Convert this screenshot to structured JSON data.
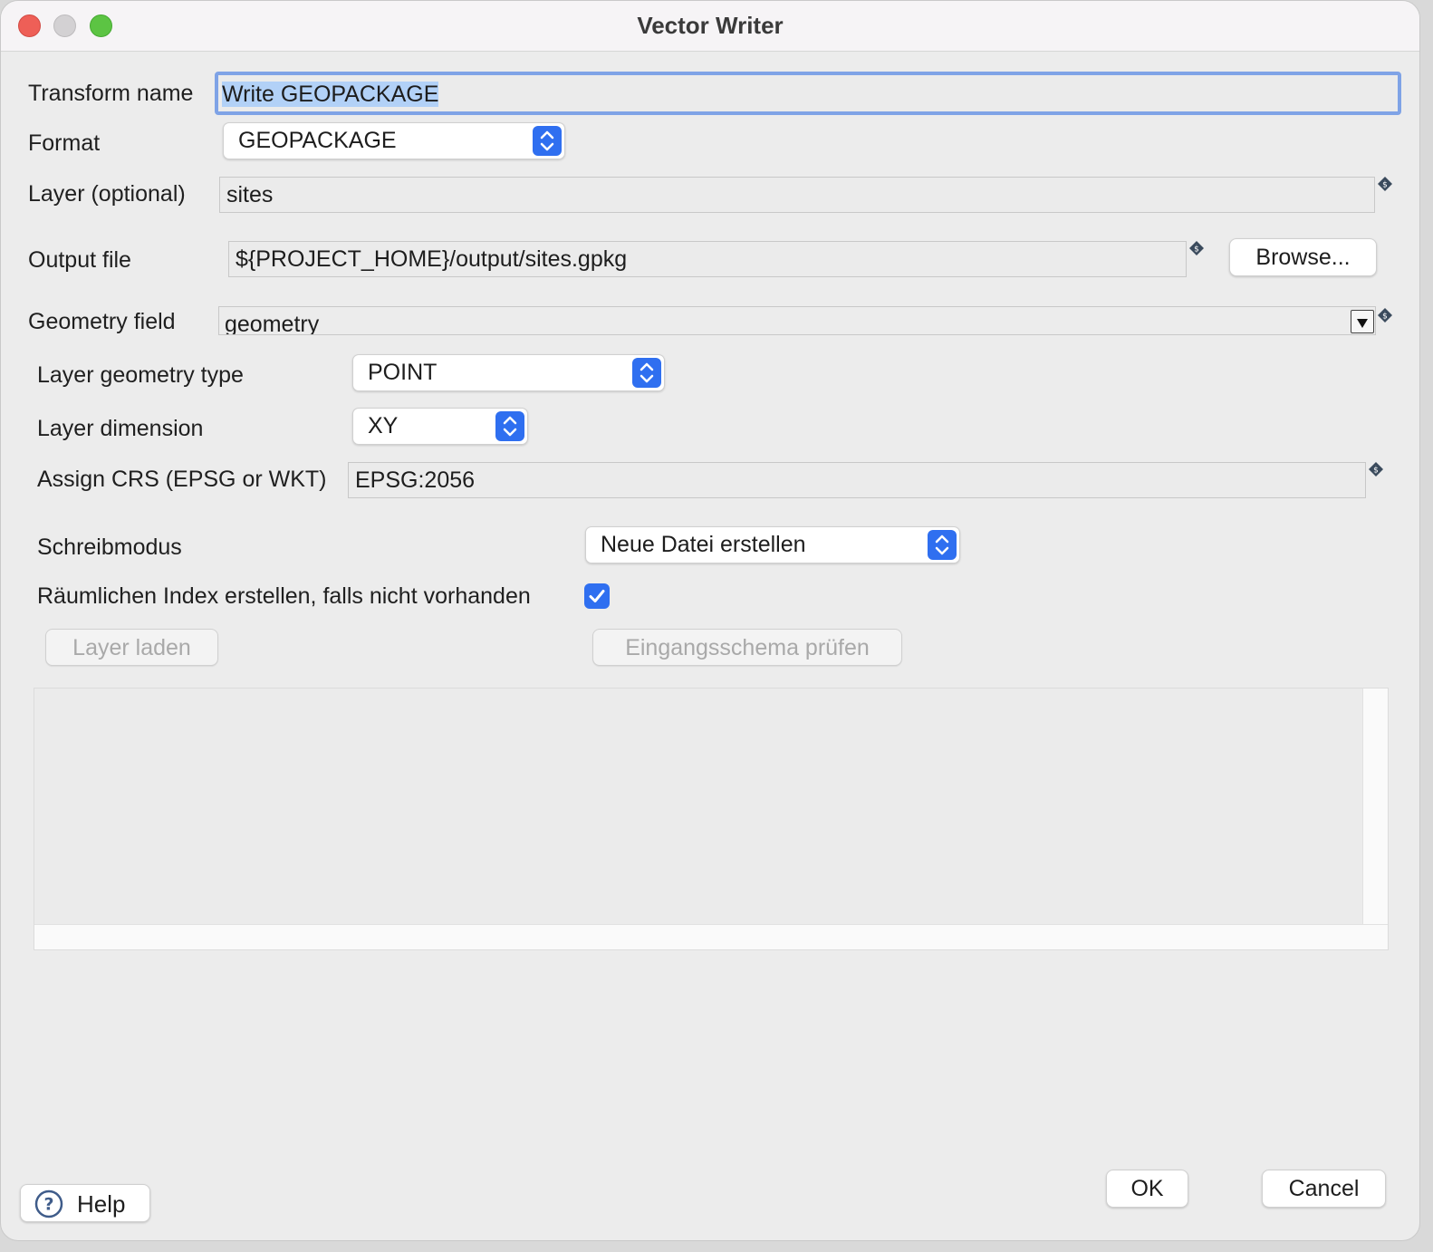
{
  "window": {
    "title": "Vector Writer"
  },
  "form": {
    "transform_name": {
      "label": "Transform name",
      "value": "Write GEOPACKAGE"
    },
    "format": {
      "label": "Format",
      "value": "GEOPACKAGE"
    },
    "layer": {
      "label": "Layer (optional)",
      "value": "sites"
    },
    "output_file": {
      "label": "Output file",
      "value": "${PROJECT_HOME}/output/sites.gpkg",
      "browse_label": "Browse..."
    },
    "geometry_field": {
      "label": "Geometry field",
      "value": "geometry"
    },
    "layer_geometry_type": {
      "label": "Layer geometry type",
      "value": "POINT"
    },
    "layer_dimension": {
      "label": "Layer dimension",
      "value": "XY"
    },
    "assign_crs": {
      "label": "Assign CRS (EPSG or WKT)",
      "value": "EPSG:2056"
    },
    "write_mode": {
      "label": "Schreibmodus",
      "value": "Neue Datei erstellen"
    },
    "spatial_index": {
      "label": "Räumlichen Index erstellen, falls nicht vorhanden",
      "checked": true
    }
  },
  "actions": {
    "load_layer": "Layer laden",
    "check_schema": "Eingangsschema prüfen"
  },
  "footer": {
    "help": "Help",
    "ok": "OK",
    "cancel": "Cancel"
  },
  "colors": {
    "accent": "#2f6ff0",
    "focus_ring": "#7fa3e6",
    "selection": "#b2d1f7"
  }
}
